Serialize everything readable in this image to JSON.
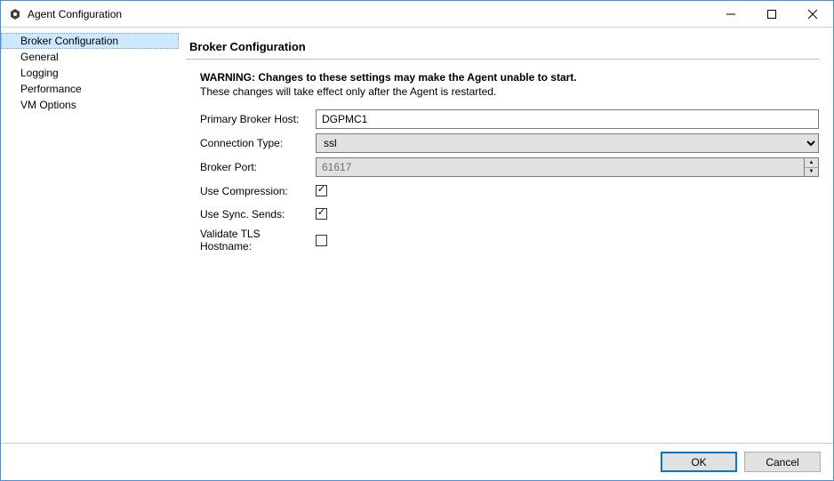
{
  "window": {
    "title": "Agent Configuration"
  },
  "sidebar": {
    "items": [
      {
        "label": "Broker Configuration",
        "selected": true
      },
      {
        "label": "General",
        "selected": false
      },
      {
        "label": "Logging",
        "selected": false
      },
      {
        "label": "Performance",
        "selected": false
      },
      {
        "label": "VM Options",
        "selected": false
      }
    ]
  },
  "content": {
    "header": "Broker Configuration",
    "warning_bold": "WARNING: Changes to these settings may make the Agent unable to start.",
    "warning_sub": "These changes will take effect only after the Agent is restarted.",
    "fields": {
      "primary_broker_host": {
        "label": "Primary Broker Host:",
        "value": "DGPMC1"
      },
      "connection_type": {
        "label": "Connection Type:",
        "value": "ssl"
      },
      "broker_port": {
        "label": "Broker Port:",
        "value": "61617"
      },
      "use_compression": {
        "label": "Use Compression:",
        "checked": true
      },
      "use_sync_sends": {
        "label": "Use Sync. Sends:",
        "checked": true
      },
      "validate_tls_hostname": {
        "label": "Validate TLS Hostname:",
        "checked": false
      }
    }
  },
  "footer": {
    "ok": "OK",
    "cancel": "Cancel"
  }
}
